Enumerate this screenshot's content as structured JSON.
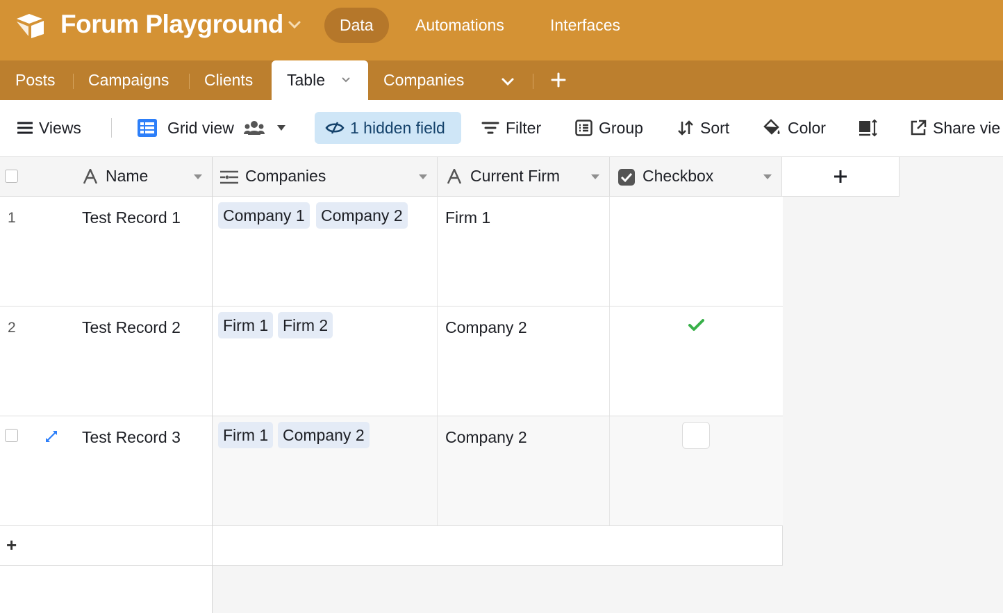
{
  "app": {
    "base_title": "Forum Playground",
    "nav": [
      "Data",
      "Automations",
      "Interfaces"
    ],
    "active_nav": "Data",
    "header_color": "#d49234"
  },
  "tabs": {
    "items": [
      "Posts",
      "Campaigns",
      "Clients",
      "Table",
      "Companies"
    ],
    "active": "Table"
  },
  "toolbar": {
    "views": "Views",
    "grid_view": "Grid view",
    "hidden_fields": "1 hidden field",
    "filter": "Filter",
    "group": "Group",
    "sort": "Sort",
    "color": "Color",
    "share": "Share vie"
  },
  "table": {
    "columns": [
      {
        "label": "Name",
        "type": "text-icon"
      },
      {
        "label": "Companies",
        "type": "link-icon"
      },
      {
        "label": "Current Firm",
        "type": "text-icon"
      },
      {
        "label": "Checkbox",
        "type": "checkbox-icon"
      }
    ],
    "rows": [
      {
        "num": "1",
        "name": "Test Record 1",
        "companies": [
          "Company 1",
          "Company 2"
        ],
        "current_firm": "Firm 1",
        "checked": null
      },
      {
        "num": "2",
        "name": "Test Record 2",
        "companies": [
          "Firm 1",
          "Firm 2"
        ],
        "current_firm": "Company 2",
        "checked": true
      },
      {
        "num": "",
        "name": "Test Record 3",
        "companies": [
          "Firm 1",
          "Company 2"
        ],
        "current_firm": "Company 2",
        "checked": false
      }
    ],
    "add_row": "+",
    "add_field": "+"
  },
  "colors": {
    "accent": "#d49234",
    "tab_bar": "#bc7f2e",
    "chip": "#e4ebf6",
    "check_green": "#38b049",
    "hidden_pill": "#cfe6f7"
  }
}
